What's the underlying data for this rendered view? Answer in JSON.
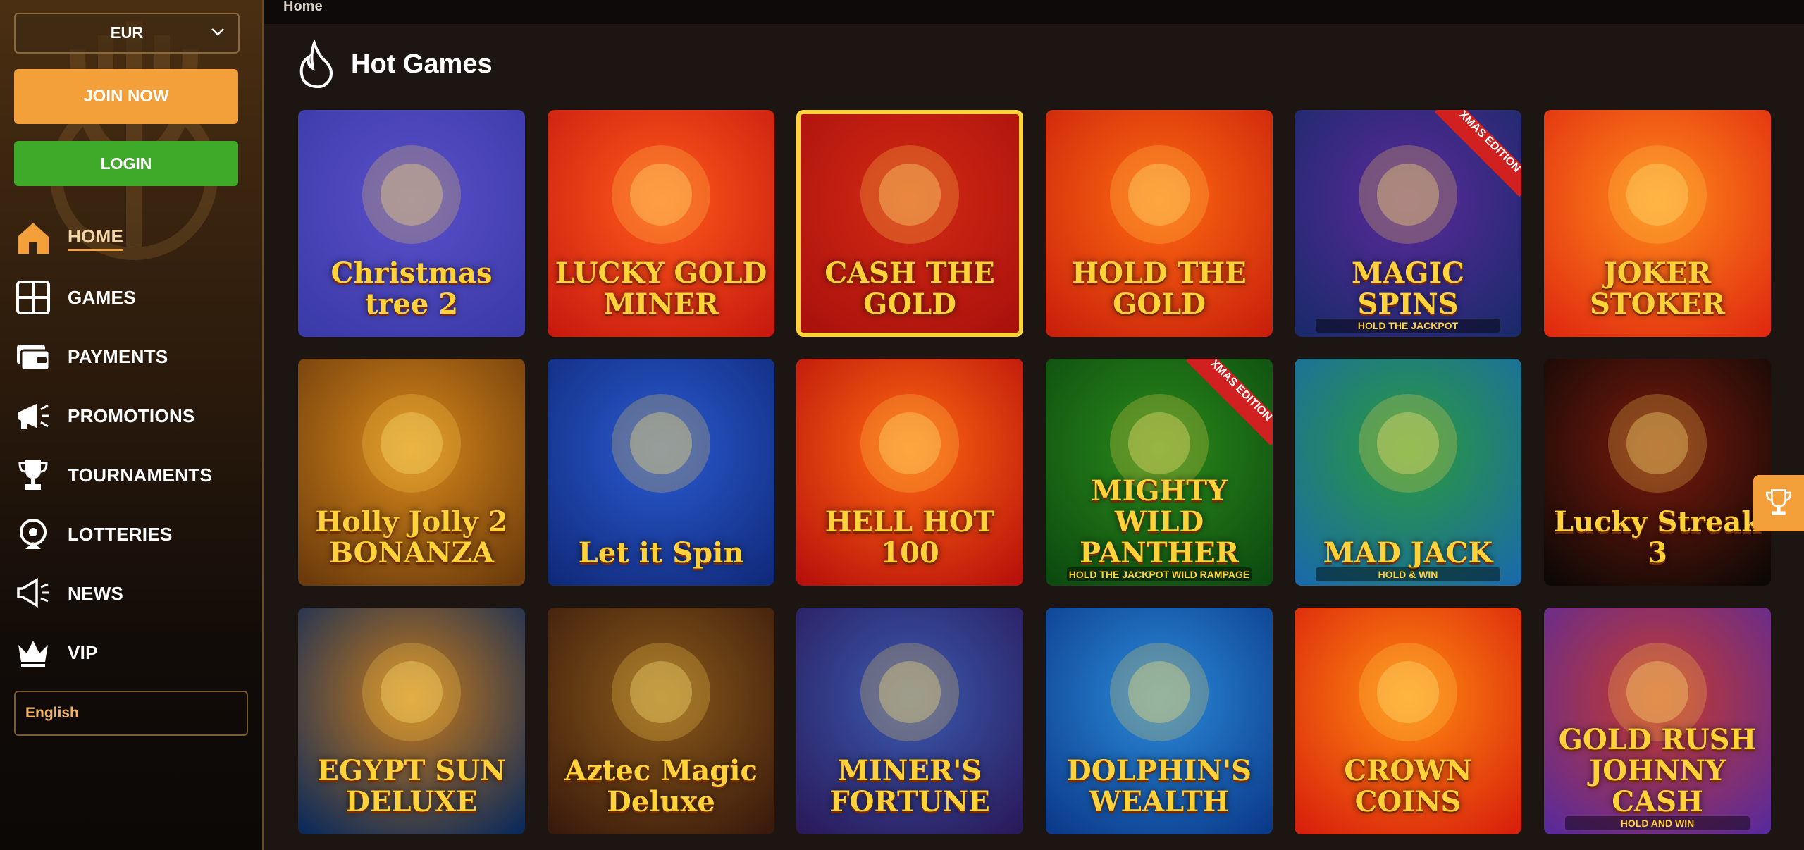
{
  "sidebar": {
    "currency": "EUR",
    "join_label": "JOIN NOW",
    "login_label": "LOGIN",
    "nav": [
      {
        "label": "HOME",
        "icon": "home-icon",
        "active": true
      },
      {
        "label": "GAMES",
        "icon": "grid-icon"
      },
      {
        "label": "PAYMENTS",
        "icon": "wallet-icon"
      },
      {
        "label": "PROMOTIONS",
        "icon": "megaphone-icon"
      },
      {
        "label": "TOURNAMENTS",
        "icon": "trophy-icon"
      },
      {
        "label": "LOTTERIES",
        "icon": "lottery-wheel-icon"
      },
      {
        "label": "NEWS",
        "icon": "announcement-icon"
      },
      {
        "label": "VIP",
        "icon": "crown-icon"
      }
    ],
    "language": "English"
  },
  "topbar": {
    "breadcrumb": "Home"
  },
  "section": {
    "title": "Hot Games",
    "icon": "flame-icon"
  },
  "games": [
    {
      "name": "Christmas tree 2",
      "colors": [
        "#3a3aa8",
        "#5a4fc8"
      ]
    },
    {
      "name": "LUCKY GOLD MINER",
      "colors": [
        "#c81a10",
        "#ff5a1a"
      ]
    },
    {
      "name": "CASH THE GOLD",
      "colors": [
        "#a8100c",
        "#d42a14"
      ]
    },
    {
      "name": "HOLD THE GOLD",
      "colors": [
        "#c8200c",
        "#ff6a10"
      ]
    },
    {
      "name": "MAGIC SPINS",
      "colors": [
        "#1a2a6a",
        "#5a2a9a"
      ],
      "ribbon": "XMAS EDITION",
      "sub": "HOLD THE JACKPOT"
    },
    {
      "name": "JOKER STOKER",
      "colors": [
        "#e02a10",
        "#ff8a1a"
      ]
    },
    {
      "name": "Holly Jolly 2 BONANZA",
      "colors": [
        "#6a3a0c",
        "#d8881a"
      ]
    },
    {
      "name": "Let it Spin",
      "colors": [
        "#102a7a",
        "#2a5ad0"
      ]
    },
    {
      "name": "HELL HOT 100",
      "colors": [
        "#b8100c",
        "#ff6a10"
      ]
    },
    {
      "name": "MIGHTY WILD PANTHER",
      "colors": [
        "#0c4a10",
        "#2a8a1a"
      ],
      "ribbon": "XMAS EDITION",
      "sub": "HOLD THE JACKPOT WILD RAMPAGE"
    },
    {
      "name": "MAD JACK",
      "colors": [
        "#1a6aa8",
        "#2a9a3a"
      ],
      "sub": "HOLD & WIN"
    },
    {
      "name": "Lucky Streak 3",
      "colors": [
        "#0c0806",
        "#7a1a0c"
      ]
    },
    {
      "name": "EGYPT SUN DELUXE",
      "colors": [
        "#0c2a5a",
        "#c87a1a"
      ]
    },
    {
      "name": "Aztec Magic Deluxe",
      "colors": [
        "#3a1a0c",
        "#8a5a1a"
      ]
    },
    {
      "name": "MINER'S FORTUNE",
      "colors": [
        "#2a1a5a",
        "#3a5ab0"
      ]
    },
    {
      "name": "DOLPHIN'S WEALTH",
      "colors": [
        "#0c3a8a",
        "#2a8ad8"
      ]
    },
    {
      "name": "CROWN COINS",
      "colors": [
        "#d8200c",
        "#ff8a10"
      ]
    },
    {
      "name": "GOLD RUSH JOHNNY CASH",
      "colors": [
        "#5a2a9a",
        "#c83a2a"
      ],
      "sub": "HOLD AND WIN"
    }
  ]
}
